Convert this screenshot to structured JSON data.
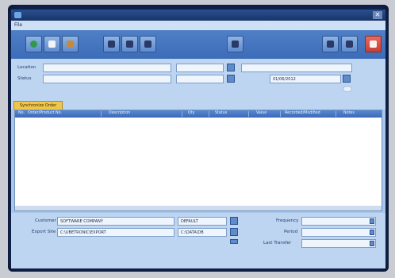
{
  "titlebar": {
    "close_label": "✕"
  },
  "menu": {
    "items": [
      {
        "label": "File"
      }
    ]
  },
  "toolbar": {
    "left_buttons": [
      {
        "name": "refresh-icon"
      },
      {
        "name": "copy-icon"
      },
      {
        "name": "tools-icon"
      }
    ],
    "edit_buttons": [
      {
        "name": "edit-icon"
      },
      {
        "name": "print-icon"
      },
      {
        "name": "export-icon"
      }
    ],
    "middle_button": {
      "name": "swap-icon"
    },
    "right_buttons": [
      {
        "name": "back-icon"
      },
      {
        "name": "forward-icon"
      }
    ],
    "exit_button": {
      "name": "exit-icon"
    }
  },
  "filters": {
    "row1_label": "Location",
    "row2_label": "Status",
    "row1_value": "",
    "row2_value": "",
    "date_value": "01/06/2012"
  },
  "tab": {
    "label": "Synchronize Order"
  },
  "grid": {
    "columns": [
      "No.",
      "Order/Product No.",
      "Description",
      "Qty",
      "Status",
      "Value",
      "Recorded/Modified",
      "Notes"
    ]
  },
  "footer": {
    "row1_label": "Customer",
    "row2_label": "Export Site",
    "row1_value": "SOFTWARE COMPANY",
    "row2_value": "C:\\UBETRONIC\\EXPORT",
    "row1_extra": "DEFAULT",
    "row2_extra": "C:\\DATA\\DB",
    "right_labels": [
      "Frequency",
      "Period",
      "Last Transfer"
    ]
  },
  "colors": {
    "titlebar": "#193569",
    "toolbar": "#3d6cb8",
    "panel": "#bdd5f1",
    "tab": "#f0c64a",
    "grid_header": "#3a69b8",
    "exit": "#c73f35"
  }
}
